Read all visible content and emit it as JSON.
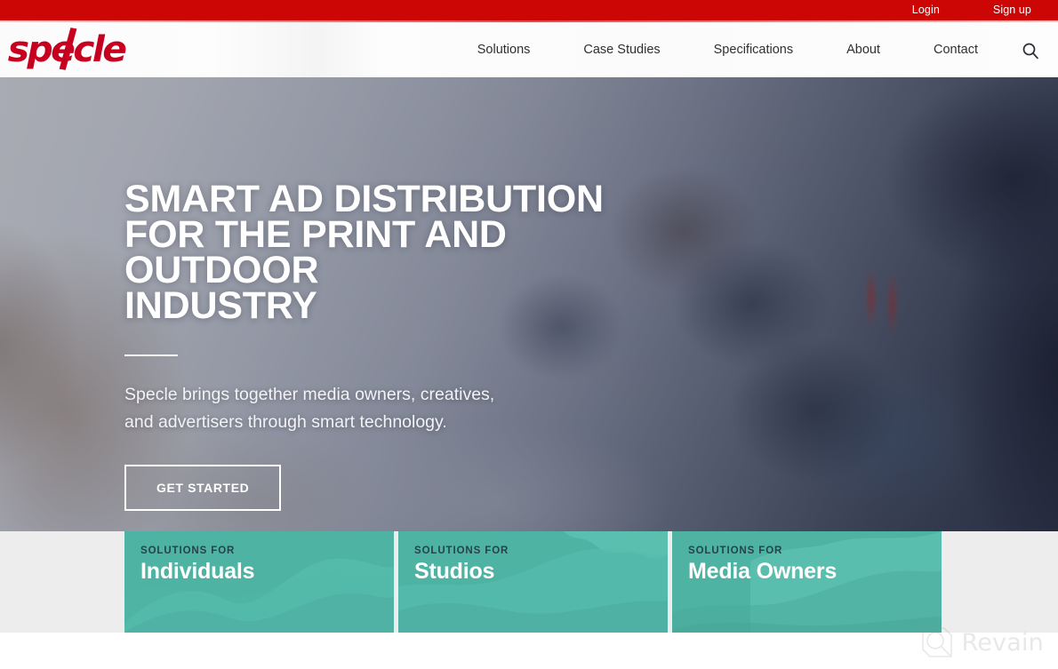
{
  "topbar": {
    "login_label": "Login",
    "signup_label": "Sign up",
    "background_color": "#cc0505"
  },
  "header": {
    "logo_text": "specle",
    "logo_color": "#c7001f",
    "search_icon": "search-icon",
    "nav": [
      {
        "label": "Solutions"
      },
      {
        "label": "Case Studies"
      },
      {
        "label": "Specifications"
      },
      {
        "label": "About"
      },
      {
        "label": "Contact"
      }
    ]
  },
  "hero": {
    "title_line_1": "SMART AD DISTRIBUTION",
    "title_line_2": "FOR THE PRINT AND OUTDOOR",
    "title_line_3": "INDUSTRY",
    "subtitle_line_1": "Specle brings together media owners, creatives,",
    "subtitle_line_2": "and advertisers through smart technology.",
    "cta_label": "GET STARTED"
  },
  "solutions": {
    "accent_color": "#4fb3a3",
    "cards": [
      {
        "kicker": "SOLUTIONS FOR",
        "title": "Individuals"
      },
      {
        "kicker": "SOLUTIONS FOR",
        "title": "Studios"
      },
      {
        "kicker": "SOLUTIONS FOR",
        "title": "Media Owners"
      }
    ]
  },
  "watermark": {
    "label": "Revain",
    "icon": "revain-logo-icon"
  }
}
